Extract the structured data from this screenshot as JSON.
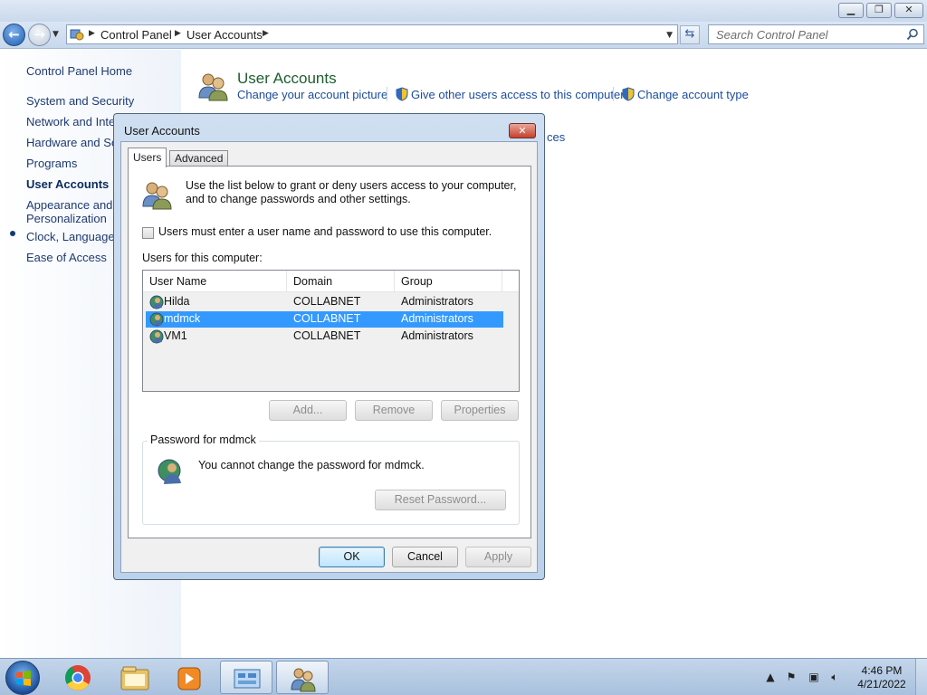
{
  "explorer": {
    "breadcrumbs": [
      "Control Panel",
      "User Accounts"
    ],
    "search_placeholder": "Search Control Panel"
  },
  "left_pane": {
    "items": [
      {
        "label": "Control Panel Home"
      },
      {
        "label": "System and Security"
      },
      {
        "label": "Network and Inter"
      },
      {
        "label": "Hardware and Sou"
      },
      {
        "label": "Programs"
      },
      {
        "label": "User Accounts",
        "selected": true
      },
      {
        "label": "Appearance and"
      },
      {
        "label": "Personalization"
      },
      {
        "label": "Clock, Language, a"
      },
      {
        "label": "Ease of Access"
      }
    ]
  },
  "main": {
    "title": "User Accounts",
    "links": [
      "Change your account picture",
      "Give other users access to this computer",
      "Change account type"
    ],
    "partial_link": "ces"
  },
  "dialog": {
    "title": "User Accounts",
    "tabs": [
      {
        "label": "Users",
        "active": true
      },
      {
        "label": "Advanced"
      }
    ],
    "intro": "Use the list below to grant or deny users access to your computer, and to change passwords and other settings.",
    "require_password_label": "Users must enter a user name and password to use this computer.",
    "require_password_checked": false,
    "users_label": "Users for this computer:",
    "columns": [
      "User Name",
      "Domain",
      "Group"
    ],
    "users": [
      {
        "name": "Hilda",
        "domain": "COLLABNET",
        "group": "Administrators"
      },
      {
        "name": "mdmck",
        "domain": "COLLABNET",
        "group": "Administrators",
        "selected": true
      },
      {
        "name": "VM1",
        "domain": "COLLABNET",
        "group": "Administrators"
      }
    ],
    "buttons": {
      "add": "Add...",
      "remove": "Remove",
      "properties": "Properties"
    },
    "password_group_label": "Password for mdmck",
    "password_text": "You cannot change the password for mdmck.",
    "reset_password": "Reset Password...",
    "ok": "OK",
    "cancel": "Cancel",
    "apply": "Apply"
  },
  "taskbar": {
    "apps": [
      "chrome-icon",
      "explorer-icon",
      "media-player-icon",
      "control-panel-icon",
      "user-accounts-icon"
    ],
    "time": "4:46 PM",
    "date": "4/21/2022"
  },
  "colors": {
    "selection": "#3399ff",
    "link": "#1c4b9b",
    "title_green": "#1d5e30"
  }
}
